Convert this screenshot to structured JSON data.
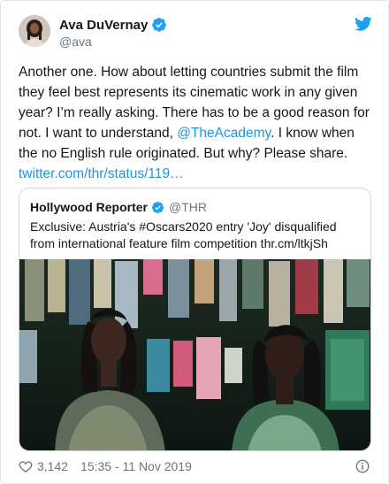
{
  "author": {
    "display_name": "Ava DuVernay",
    "handle": "@ava",
    "avatar_icon": "avatar-photo",
    "verified_icon": "verified-badge-icon"
  },
  "tweet": {
    "text_parts": [
      "Another one. How about letting countries submit the film they feel best represents its cinematic work in any given year? I’m really asking. There has to be a good reason for not. I want to understand, ",
      "@TheAcademy",
      ". I know when the no English rule originated. But why? Please share. ",
      "twitter.com/thr/status/119…"
    ]
  },
  "quoted": {
    "display_name": "Hollywood Reporter",
    "handle": "@THR",
    "text": "Exclusive: Austria's #Oscars2020 entry 'Joy' disqualified from international feature film competition thr.cm/ltkjSh"
  },
  "footer": {
    "likes": "3,142",
    "timestamp": "15:35 - 11 Nov 2019"
  },
  "colors": {
    "link": "#1b95e0",
    "brand": "#1da1f2",
    "muted": "#657786"
  }
}
